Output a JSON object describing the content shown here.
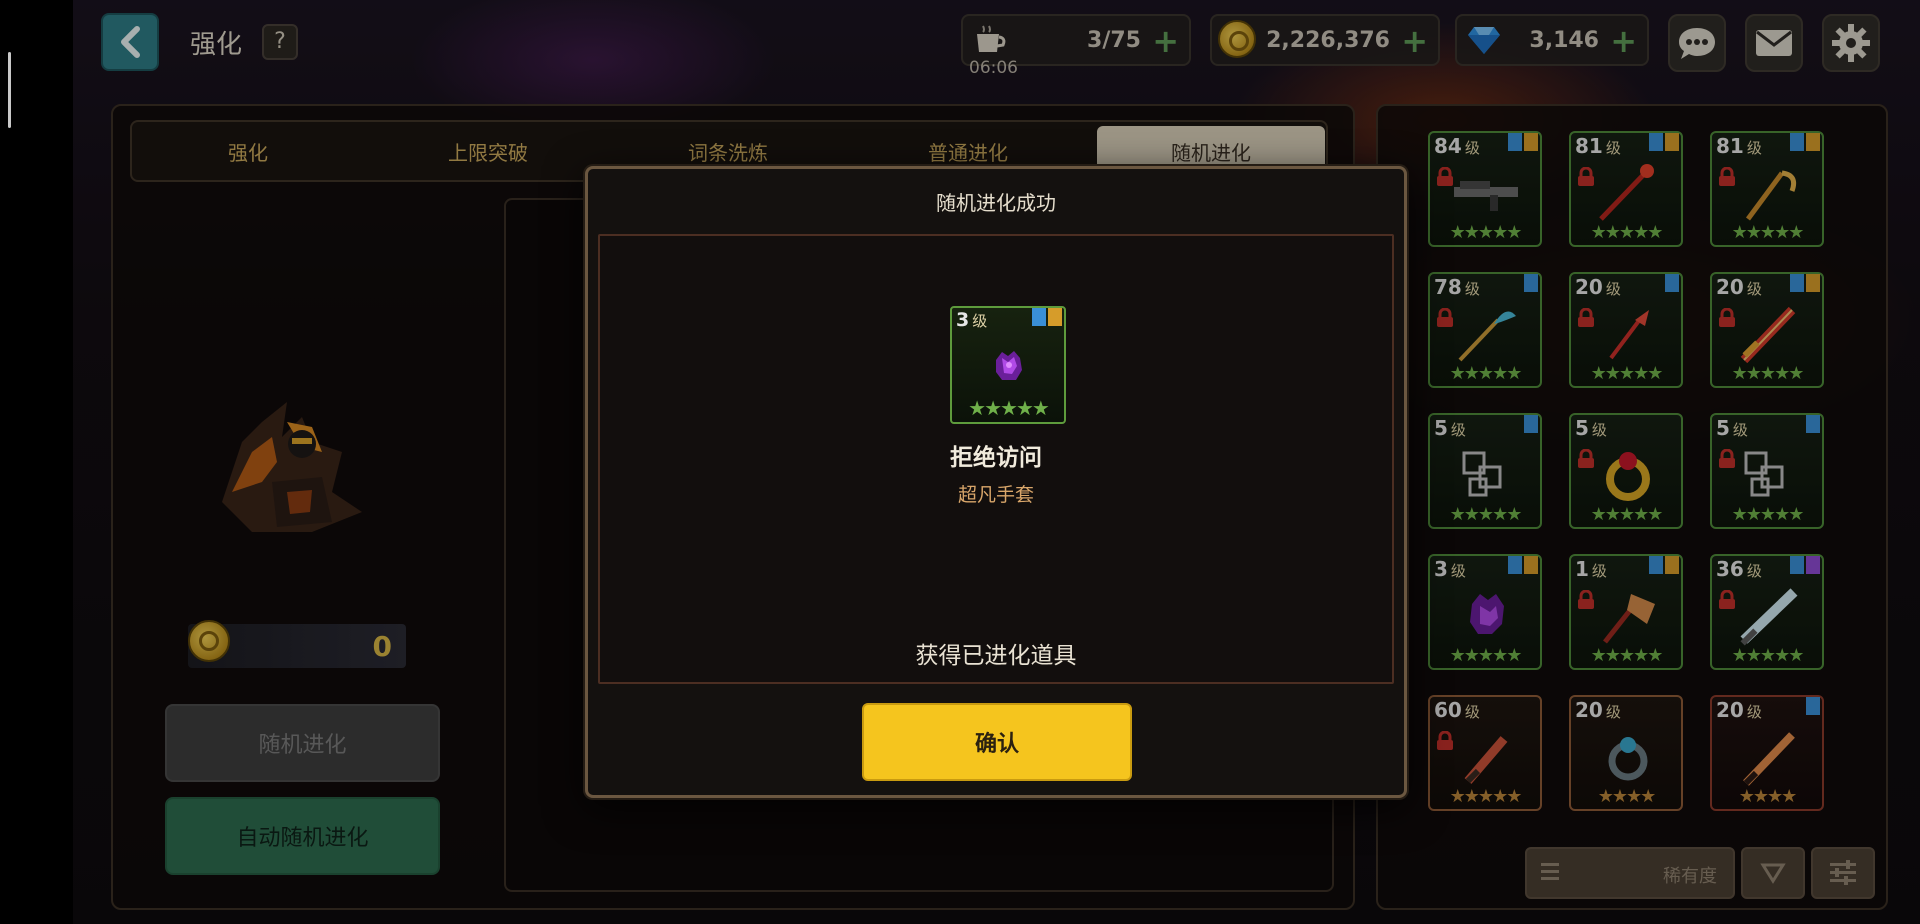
{
  "header": {
    "title": "强化",
    "help_label": "?",
    "back_icon": "chevron-left-icon"
  },
  "resources": {
    "stamina": {
      "icon": "coffee-cup-icon",
      "value": "3/75",
      "timer": "06:06"
    },
    "gold": {
      "icon": "gold-coin-icon",
      "value": "2,226,376"
    },
    "gems": {
      "icon": "diamond-icon",
      "value": "3,146"
    },
    "plus": "+"
  },
  "header_buttons": [
    "chat-bubble-icon",
    "mail-icon",
    "settings-gear-icon"
  ],
  "tabs": [
    {
      "label": "强化",
      "active": false
    },
    {
      "label": "上限突破",
      "active": false
    },
    {
      "label": "词条洗炼",
      "active": false
    },
    {
      "label": "普通进化",
      "active": false
    },
    {
      "label": "随机进化",
      "active": true
    }
  ],
  "left_panel": {
    "cost": "0",
    "random_evolve_label": "随机进化",
    "auto_evolve_label": "自动随机进化"
  },
  "modal": {
    "title": "随机进化成功",
    "item": {
      "level": "3",
      "level_unit": "级",
      "stars": "★★★★★"
    },
    "item_name": "拒绝访问",
    "item_type": "超凡手套",
    "message": "获得已进化道具",
    "confirm_label": "确认"
  },
  "inventory": [
    {
      "level": "84",
      "unit": "级",
      "stars": "★★★★★",
      "locked": true,
      "flags": [
        "blue",
        "gold"
      ],
      "rarity": "green",
      "art": "gun"
    },
    {
      "level": "81",
      "unit": "级",
      "stars": "★★★★★",
      "locked": true,
      "flags": [
        "blue",
        "gold"
      ],
      "rarity": "green",
      "art": "staff"
    },
    {
      "level": "81",
      "unit": "级",
      "stars": "★★★★★",
      "locked": true,
      "flags": [
        "blue",
        "gold"
      ],
      "rarity": "green",
      "art": "scythe"
    },
    {
      "level": "78",
      "unit": "级",
      "stars": "★★★★★",
      "locked": true,
      "flags": [
        "blue"
      ],
      "rarity": "green",
      "art": "wand"
    },
    {
      "level": "20",
      "unit": "级",
      "stars": "★★★★★",
      "locked": true,
      "flags": [
        "blue"
      ],
      "rarity": "green",
      "art": "fish-staff"
    },
    {
      "level": "20",
      "unit": "级",
      "stars": "★★★★★",
      "locked": true,
      "flags": [
        "blue",
        "gold"
      ],
      "rarity": "green",
      "art": "red-sword"
    },
    {
      "level": "5",
      "unit": "级",
      "stars": "★★★★★",
      "locked": false,
      "flags": [
        "blue"
      ],
      "rarity": "green",
      "art": "squares"
    },
    {
      "level": "5",
      "unit": "级",
      "stars": "★★★★★",
      "locked": true,
      "flags": [],
      "rarity": "green",
      "art": "ring"
    },
    {
      "level": "5",
      "unit": "级",
      "stars": "★★★★★",
      "locked": true,
      "flags": [
        "blue"
      ],
      "rarity": "green",
      "art": "squares"
    },
    {
      "level": "3",
      "unit": "级",
      "stars": "★★★★★",
      "locked": false,
      "flags": [
        "blue",
        "gold"
      ],
      "rarity": "green",
      "art": "glove"
    },
    {
      "level": "1",
      "unit": "级",
      "stars": "★★★★★",
      "locked": true,
      "flags": [
        "blue",
        "gold"
      ],
      "rarity": "green",
      "art": "axe"
    },
    {
      "level": "36",
      "unit": "级",
      "stars": "★★★★★",
      "locked": true,
      "flags": [
        "blue",
        "purple"
      ],
      "rarity": "green",
      "art": "light-sword"
    },
    {
      "level": "60",
      "unit": "级",
      "stars": "★★★★★",
      "locked": true,
      "flags": [],
      "rarity": "orange",
      "art": "blade"
    },
    {
      "level": "20",
      "unit": "级",
      "stars": "★★★★",
      "locked": false,
      "flags": [],
      "rarity": "orange",
      "art": "ring-dark"
    },
    {
      "level": "20",
      "unit": "级",
      "stars": "★★★★",
      "locked": false,
      "flags": [
        "blue"
      ],
      "rarity": "red",
      "art": "blade2"
    }
  ],
  "sort": {
    "label": "稀有度",
    "menu_icon": "list-icon",
    "direction_icon": "triangle-down-icon",
    "filter_icon": "sliders-icon"
  },
  "colors": {
    "accent_yellow": "#f5c51e",
    "green_button": "#2d6b4e",
    "back_button": "#2e7c86",
    "star_green": "#6fb04a"
  }
}
